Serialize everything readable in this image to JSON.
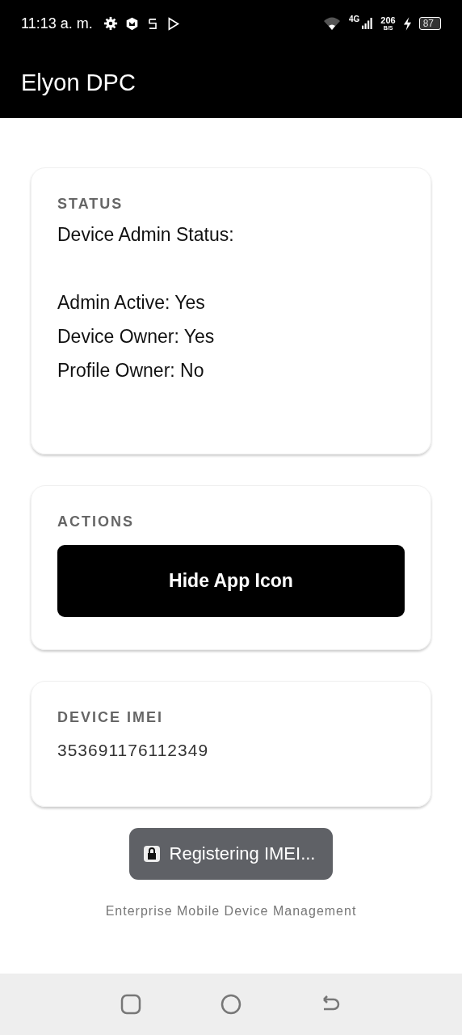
{
  "status_bar": {
    "time": "11:13 a. m.",
    "network": "4G",
    "speed": "206",
    "speed_unit": "B/S",
    "battery": "87"
  },
  "app_bar": {
    "title": "Elyon DPC"
  },
  "status_card": {
    "label": "STATUS",
    "heading": "Device Admin Status:",
    "lines": [
      "Admin Active: Yes",
      "Device Owner: Yes",
      "Profile Owner: No"
    ]
  },
  "actions_card": {
    "label": "ACTIONS",
    "button": "Hide App Icon"
  },
  "imei_card": {
    "label": "DEVICE IMEI",
    "value": "353691176112349"
  },
  "toast": {
    "text": "Registering IMEI..."
  },
  "footer": "Enterprise Mobile Device Management"
}
